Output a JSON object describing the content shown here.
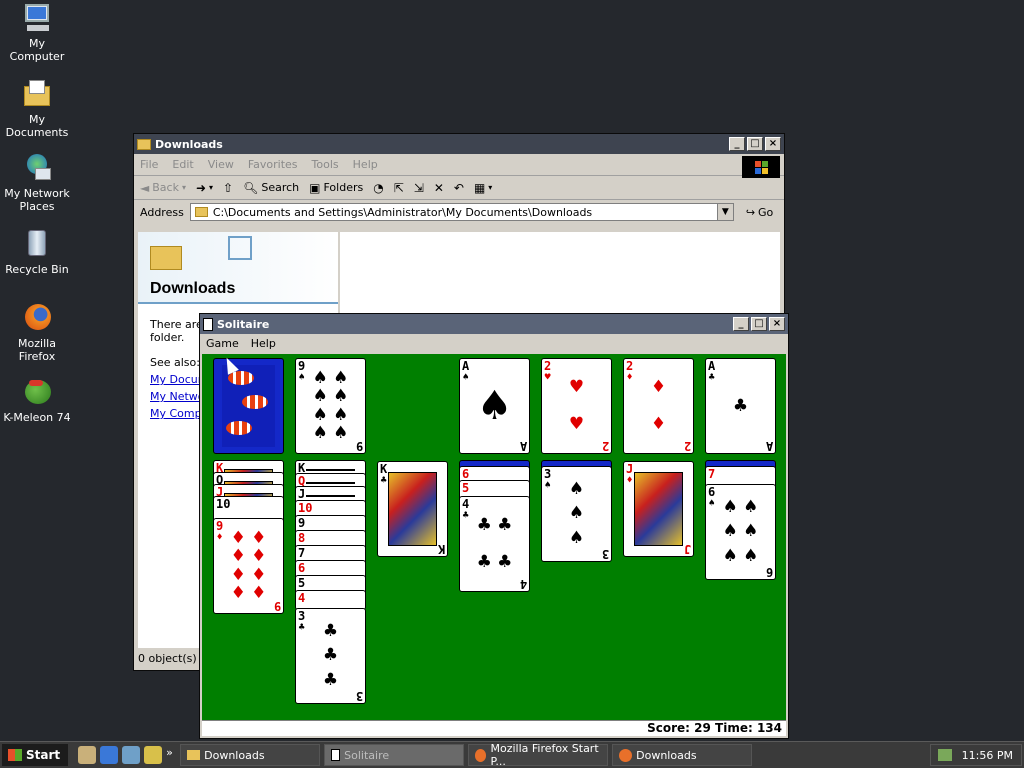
{
  "desktop": {
    "icons": [
      {
        "label": "My Computer",
        "icon": "computer-icon"
      },
      {
        "label": "My Documents",
        "icon": "folder-icon"
      },
      {
        "label": "My Network Places",
        "icon": "network-icon"
      },
      {
        "label": "Recycle Bin",
        "icon": "recycle-bin-icon"
      },
      {
        "label": "Mozilla Firefox",
        "icon": "firefox-icon"
      },
      {
        "label": "K-Meleon 74",
        "icon": "kmeleon-icon"
      }
    ]
  },
  "explorer": {
    "title": "Downloads",
    "menu": [
      "File",
      "Edit",
      "View",
      "Favorites",
      "Tools",
      "Help"
    ],
    "toolbar": {
      "back": "Back",
      "search": "Search",
      "folders": "Folders"
    },
    "address_label": "Address",
    "address_value": "C:\\Documents and Settings\\Administrator\\My Documents\\Downloads",
    "go_label": "Go",
    "pane_title": "Downloads",
    "pane_text": "There are",
    "pane_text2": "folder.",
    "see_also": "See also:",
    "links": [
      "My Docum",
      "My Netwo",
      "My Compu"
    ],
    "status": "0 object(s)"
  },
  "solitaire": {
    "title": "Solitaire",
    "menu": [
      "Game",
      "Help"
    ],
    "score_label": "Score: 29 Time: 134",
    "cards": {
      "nine_spades": {
        "rank": "9",
        "suit": "♠"
      },
      "ace_spades": {
        "rank": "A",
        "suit": "♠"
      },
      "two_hearts": {
        "rank": "2",
        "suit": "♥"
      },
      "two_diamonds": {
        "rank": "2",
        "suit": "♦"
      },
      "ace_clubs": {
        "rank": "A",
        "suit": "♣"
      },
      "nine_diamonds": {
        "rank": "9",
        "suit": "♦"
      },
      "three_clubs": {
        "rank": "3",
        "suit": "♣"
      },
      "king_clubs": {
        "rank": "K",
        "suit": "♣"
      },
      "four_clubs": {
        "rank": "4",
        "suit": "♣"
      },
      "three_spades": {
        "rank": "3",
        "suit": "♠"
      },
      "jack_diamonds": {
        "rank": "J",
        "suit": "♦"
      },
      "six_spades": {
        "rank": "6",
        "suit": "♠"
      }
    },
    "col1_stack": [
      "K",
      "Q",
      "J",
      "10"
    ],
    "col2_stack": [
      "K",
      "Q",
      "J",
      "10",
      "9",
      "8",
      "7",
      "6",
      "5",
      "4"
    ],
    "col4_stack": [
      "6",
      "5"
    ],
    "col7_stack": [
      "7"
    ]
  },
  "taskbar": {
    "start": "Start",
    "tasks": [
      "Downloads",
      "Solitaire",
      "Mozilla Firefox Start P...",
      "Downloads"
    ],
    "clock": "11:56 PM"
  }
}
